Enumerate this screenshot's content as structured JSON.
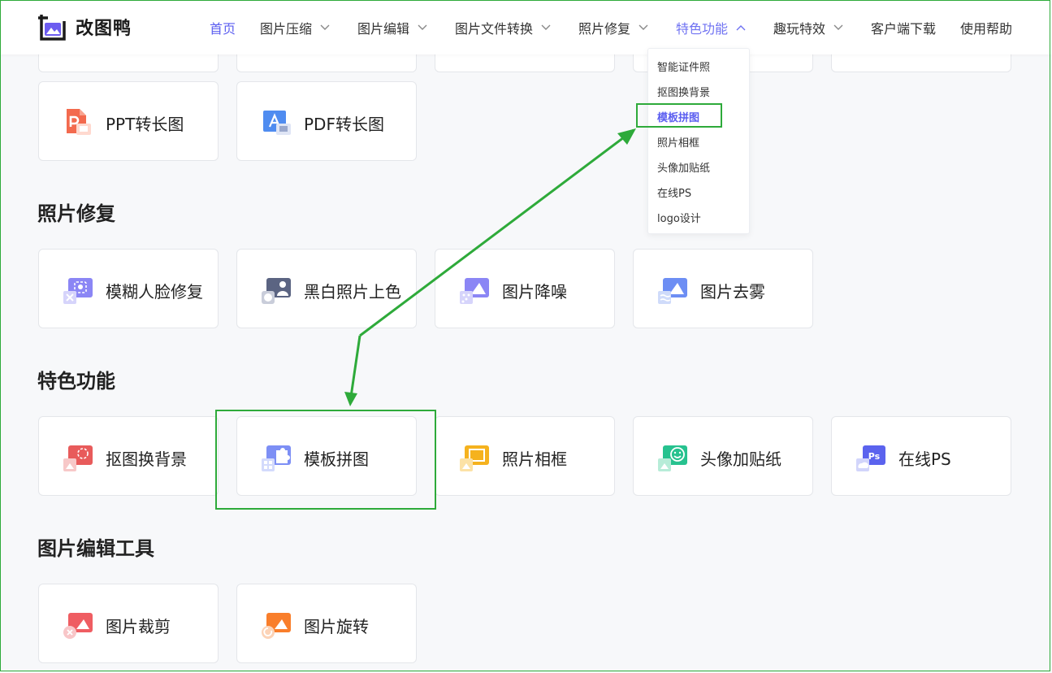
{
  "brand": {
    "name": "改图鸭"
  },
  "nav": [
    {
      "label": "首页",
      "state": "active"
    },
    {
      "label": "图片压缩",
      "caret": "down"
    },
    {
      "label": "图片编辑",
      "caret": "down"
    },
    {
      "label": "图片文件转换",
      "caret": "down"
    },
    {
      "label": "照片修复",
      "caret": "down"
    },
    {
      "label": "特色功能",
      "caret": "up",
      "state": "open"
    },
    {
      "label": "趣玩特效",
      "caret": "down"
    },
    {
      "label": "客户端下载"
    },
    {
      "label": "使用帮助"
    }
  ],
  "dropdown": {
    "items": [
      "智能证件照",
      "抠图换背景",
      "模板拼图",
      "照片相框",
      "头像加贴纸",
      "在线PS",
      "logo设计"
    ],
    "highlighted": "模板拼图"
  },
  "sections": {
    "conversion": {
      "cards": [
        "PPT转长图",
        "PDF转长图"
      ]
    },
    "repair": {
      "title": "照片修复",
      "cards": [
        "模糊人脸修复",
        "黑白照片上色",
        "图片降噪",
        "图片去雾"
      ]
    },
    "special": {
      "title": "特色功能",
      "cards": [
        "抠图换背景",
        "模板拼图",
        "照片相框",
        "头像加贴纸",
        "在线PS"
      ]
    },
    "editing": {
      "title": "图片编辑工具",
      "cards": [
        "图片裁剪",
        "图片旋转"
      ]
    }
  },
  "icons": {
    "ppt": "ppt-file-icon",
    "pdf": "pdf-file-icon",
    "face": "face-repair-icon",
    "colorize": "colorize-icon",
    "denoise": "denoise-icon",
    "dehaze": "dehaze-icon",
    "cutout": "cutout-icon",
    "collage": "puzzle-collage-icon",
    "frame": "photo-frame-icon",
    "sticker": "smile-sticker-icon",
    "ps": "ps-icon",
    "crop": "crop-icon",
    "rotate": "rotate-icon"
  },
  "colors": {
    "accent": "#5b5ef0",
    "annotation_green": "#2eaa3a",
    "page_bg": "#f7f8fa"
  }
}
